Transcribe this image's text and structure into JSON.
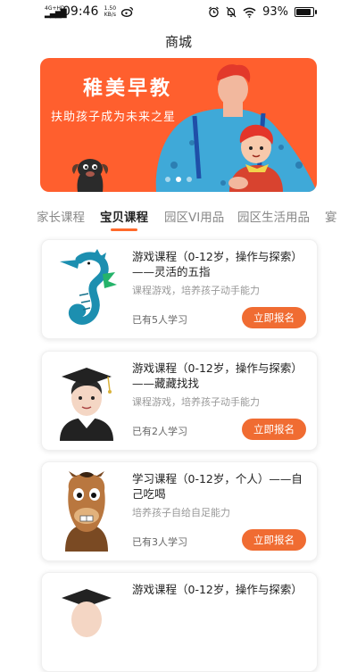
{
  "status_bar": {
    "network": "4G+HD",
    "time": "09:46",
    "speed_value": "1.50",
    "speed_unit": "KB/s",
    "battery": "93%",
    "battery_level": 0.93
  },
  "header": {
    "title": "商城"
  },
  "banner": {
    "title": "稚美早教",
    "subtitle": "扶助孩子成为未来之星",
    "slide_count": 3,
    "active_slide": 1,
    "background": "#ff5f2e"
  },
  "tabs": [
    {
      "label": "家长课程",
      "active": false
    },
    {
      "label": "宝贝课程",
      "active": true
    },
    {
      "label": "园区VI用品",
      "active": false
    },
    {
      "label": "园区生活用品",
      "active": false
    },
    {
      "label": "宴",
      "active": false
    }
  ],
  "courses": [
    {
      "title": "游戏课程（0-12岁，操作与探索）——灵活的五指",
      "desc": "课程游戏，培养孩子动手能力",
      "count": "已有5人学习",
      "button": "立即报名",
      "image": "seahorse-image"
    },
    {
      "title": "游戏课程（0-12岁，操作与探索）——藏藏找找",
      "desc": "课程游戏，培养孩子动手能力",
      "count": "已有2人学习",
      "button": "立即报名",
      "image": "graduate-image"
    },
    {
      "title": "学习课程（0-12岁，个人）——自己吃喝",
      "desc": "培养孩子自给自足能力",
      "count": "已有3人学习",
      "button": "立即报名",
      "image": "horse-image"
    },
    {
      "title": "游戏课程（0-12岁，操作与探索）",
      "desc": "",
      "count": "",
      "button": "",
      "image": "graduate-image"
    }
  ],
  "colors": {
    "accent": "#f06c32",
    "tab_underline": "#ff6a2b"
  }
}
